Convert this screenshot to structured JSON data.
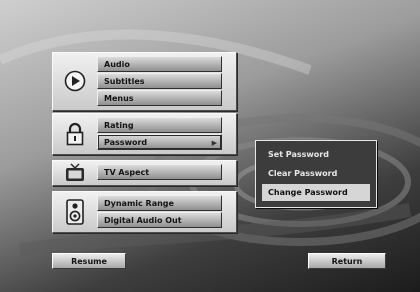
{
  "menu": {
    "groups": [
      {
        "icon": "play-disc-icon",
        "items": [
          {
            "label": "Audio"
          },
          {
            "label": "Subtitles"
          },
          {
            "label": "Menus"
          }
        ]
      },
      {
        "icon": "padlock-icon",
        "items": [
          {
            "label": "Rating"
          },
          {
            "label": "Password",
            "selected": true
          }
        ]
      },
      {
        "icon": "tv-icon",
        "items": [
          {
            "label": "TV Aspect"
          }
        ]
      },
      {
        "icon": "speaker-icon",
        "items": [
          {
            "label": "Dynamic Range"
          },
          {
            "label": "Digital Audio Out"
          }
        ]
      }
    ]
  },
  "password_submenu": {
    "items": [
      {
        "label": "Set Password"
      },
      {
        "label": "Clear Password"
      },
      {
        "label": "Change Password",
        "focused": true
      }
    ]
  },
  "footer": {
    "resume_label": "Resume",
    "return_label": "Return"
  }
}
